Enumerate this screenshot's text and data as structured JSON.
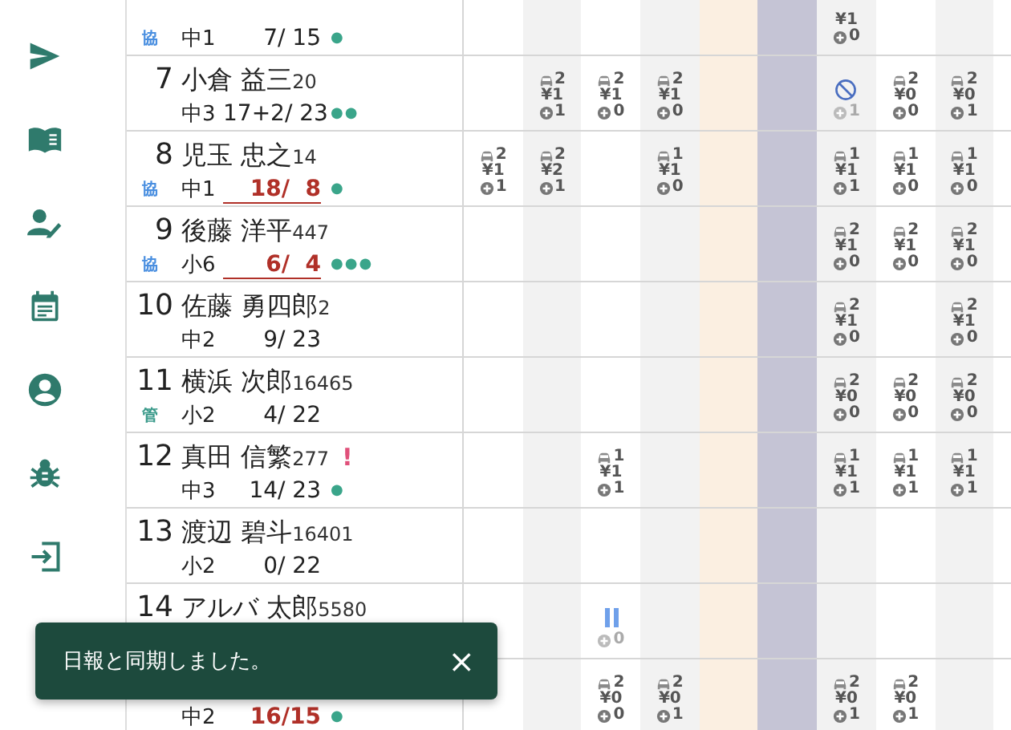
{
  "columns": [
    {
      "kind": "plain"
    },
    {
      "kind": "shaded"
    },
    {
      "kind": "plain"
    },
    {
      "kind": "shaded"
    },
    {
      "kind": "holiday"
    },
    {
      "kind": "closed"
    },
    {
      "kind": "shaded"
    },
    {
      "kind": "plain"
    },
    {
      "kind": "shaded"
    },
    {
      "kind": "plain"
    }
  ],
  "rows": [
    {
      "badge": {
        "text": "協",
        "color": "#4a8fe0"
      },
      "grade": "中1",
      "score": "7/ 15",
      "over": false,
      "dots": "●",
      "cells": [
        {
          "kind": "none"
        },
        {
          "kind": "none"
        },
        {
          "kind": "none"
        },
        {
          "kind": "none"
        },
        {
          "kind": "none"
        },
        {
          "kind": "none"
        },
        {
          "kind": "stats",
          "yen": "¥1",
          "plus": "0"
        },
        {
          "kind": "none"
        },
        {
          "kind": "none"
        }
      ]
    },
    {
      "number": "7",
      "name": "小倉 益三",
      "id": "20",
      "grade": "中3",
      "score": "17+2/ 23",
      "over": false,
      "dots": "●●",
      "cells": [
        {
          "kind": "none"
        },
        {
          "kind": "stats",
          "car": "2",
          "yen": "¥1",
          "plus": "1"
        },
        {
          "kind": "stats",
          "car": "2",
          "yen": "¥1",
          "plus": "0"
        },
        {
          "kind": "stats",
          "car": "2",
          "yen": "¥1",
          "plus": "0"
        },
        {
          "kind": "none"
        },
        {
          "kind": "none"
        },
        {
          "kind": "absent",
          "plus": "1"
        },
        {
          "kind": "stats",
          "car": "2",
          "yen": "¥0",
          "plus": "0"
        },
        {
          "kind": "stats",
          "car": "2",
          "yen": "¥0",
          "plus": "1"
        }
      ]
    },
    {
      "number": "8",
      "name": "児玉 忠之",
      "id": "14",
      "badge": {
        "text": "協",
        "color": "#4a8fe0"
      },
      "grade": "中1",
      "score": "18/  8",
      "over": true,
      "dots": "●",
      "cells": [
        {
          "kind": "stats",
          "car": "2",
          "yen": "¥1",
          "plus": "1"
        },
        {
          "kind": "stats",
          "car": "2",
          "yen": "¥2",
          "plus": "1"
        },
        {
          "kind": "none"
        },
        {
          "kind": "stats",
          "car": "1",
          "yen": "¥1",
          "plus": "0"
        },
        {
          "kind": "none"
        },
        {
          "kind": "none"
        },
        {
          "kind": "stats",
          "car": "1",
          "yen": "¥1",
          "plus": "1"
        },
        {
          "kind": "stats",
          "car": "1",
          "yen": "¥1",
          "plus": "0"
        },
        {
          "kind": "stats",
          "car": "1",
          "yen": "¥1",
          "plus": "0"
        }
      ]
    },
    {
      "number": "9",
      "name": "後藤 洋平",
      "id": "447",
      "badge": {
        "text": "協",
        "color": "#4a8fe0"
      },
      "grade": "小6",
      "score": "6/  4",
      "over": true,
      "dots": "●●●",
      "cells": [
        {
          "kind": "none"
        },
        {
          "kind": "none"
        },
        {
          "kind": "none"
        },
        {
          "kind": "none"
        },
        {
          "kind": "none"
        },
        {
          "kind": "none"
        },
        {
          "kind": "stats",
          "car": "2",
          "yen": "¥1",
          "plus": "0"
        },
        {
          "kind": "stats",
          "car": "2",
          "yen": "¥1",
          "plus": "0"
        },
        {
          "kind": "stats",
          "car": "2",
          "yen": "¥1",
          "plus": "0"
        }
      ]
    },
    {
      "number": "10",
      "name": "佐藤 勇四郎",
      "id": "2",
      "grade": "中2",
      "score": "9/ 23",
      "over": false,
      "cells": [
        {
          "kind": "none"
        },
        {
          "kind": "none"
        },
        {
          "kind": "none"
        },
        {
          "kind": "none"
        },
        {
          "kind": "none"
        },
        {
          "kind": "none"
        },
        {
          "kind": "stats",
          "car": "2",
          "yen": "¥1",
          "plus": "0"
        },
        {
          "kind": "none"
        },
        {
          "kind": "stats",
          "car": "2",
          "yen": "¥1",
          "plus": "0"
        }
      ]
    },
    {
      "number": "11",
      "name": "横浜 次郎",
      "id": "16465",
      "badge": {
        "text": "管",
        "color": "#3a9a8a"
      },
      "grade": "小2",
      "score": "4/ 22",
      "over": false,
      "cells": [
        {
          "kind": "none"
        },
        {
          "kind": "none"
        },
        {
          "kind": "none"
        },
        {
          "kind": "none"
        },
        {
          "kind": "none"
        },
        {
          "kind": "none"
        },
        {
          "kind": "stats",
          "car": "2",
          "yen": "¥0",
          "plus": "0"
        },
        {
          "kind": "stats",
          "car": "2",
          "yen": "¥0",
          "plus": "0"
        },
        {
          "kind": "stats",
          "car": "2",
          "yen": "¥0",
          "plus": "0"
        }
      ]
    },
    {
      "number": "12",
      "name": "真田 信繁",
      "id": "277",
      "alert": "!",
      "grade": "中3",
      "score": "14/ 23",
      "over": false,
      "dots": "●",
      "cells": [
        {
          "kind": "none"
        },
        {
          "kind": "none"
        },
        {
          "kind": "stats",
          "car": "1",
          "yen": "¥1",
          "plus": "1"
        },
        {
          "kind": "none"
        },
        {
          "kind": "none"
        },
        {
          "kind": "none"
        },
        {
          "kind": "stats",
          "car": "1",
          "yen": "¥1",
          "plus": "1"
        },
        {
          "kind": "stats",
          "car": "1",
          "yen": "¥1",
          "plus": "1"
        },
        {
          "kind": "stats",
          "car": "1",
          "yen": "¥1",
          "plus": "1"
        }
      ]
    },
    {
      "number": "13",
      "name": "渡辺 碧斗",
      "id": "16401",
      "grade": "小2",
      "score": "0/ 22",
      "over": false,
      "cells": [
        {
          "kind": "none"
        },
        {
          "kind": "none"
        },
        {
          "kind": "none"
        },
        {
          "kind": "none"
        },
        {
          "kind": "none"
        },
        {
          "kind": "none"
        },
        {
          "kind": "none"
        },
        {
          "kind": "none"
        },
        {
          "kind": "none"
        }
      ]
    },
    {
      "number": "14",
      "name": "アルバ 太郎",
      "id": "5580",
      "cells": [
        {
          "kind": "none"
        },
        {
          "kind": "none"
        },
        {
          "kind": "paused",
          "plus": "0"
        },
        {
          "kind": "none"
        },
        {
          "kind": "none"
        },
        {
          "kind": "none"
        },
        {
          "kind": "none"
        },
        {
          "kind": "none"
        },
        {
          "kind": "none"
        }
      ]
    },
    {
      "grade": "中2",
      "score": "16/15",
      "over": true,
      "dots": "●",
      "cells": [
        {
          "kind": "none"
        },
        {
          "kind": "none"
        },
        {
          "kind": "stats",
          "car": "2",
          "yen": "¥0",
          "plus": "0"
        },
        {
          "kind": "stats",
          "car": "2",
          "yen": "¥0",
          "plus": "1"
        },
        {
          "kind": "none"
        },
        {
          "kind": "none"
        },
        {
          "kind": "stats",
          "car": "2",
          "yen": "¥0",
          "plus": "1"
        },
        {
          "kind": "stats",
          "car": "2",
          "yen": "¥0",
          "plus": "1"
        },
        {
          "kind": "none"
        }
      ]
    }
  ],
  "toast": {
    "message": "日報と同期しました。",
    "close": "×"
  }
}
